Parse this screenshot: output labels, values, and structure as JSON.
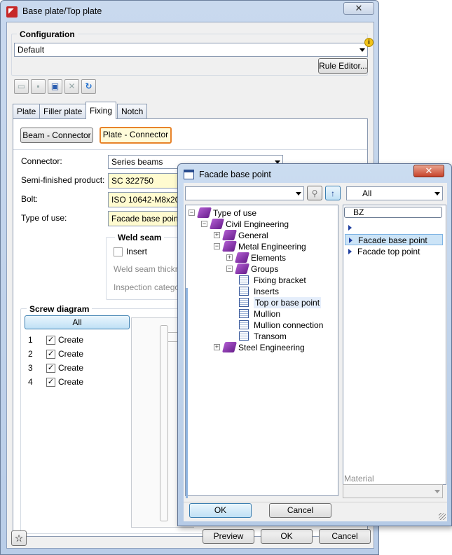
{
  "main_window": {
    "title": "Base plate/Top plate",
    "close_glyph": "✕",
    "configuration": {
      "group_label": "Configuration",
      "selected": "Default",
      "rule_editor_label": "Rule Editor..."
    },
    "tabs": [
      "Plate",
      "Filler plate",
      "Fixing",
      "Notch"
    ],
    "active_tab": "Fixing",
    "connector_buttons": {
      "beam": "Beam - Connector",
      "plate": "Plate - Connector"
    },
    "fields": {
      "connector_label": "Connector:",
      "connector_value": "Series beams",
      "semi_label": "Semi-finished product:",
      "semi_value": "SC  322750",
      "bolt_label": "Bolt:",
      "bolt_value": "ISO 10642-M8x20",
      "use_label": "Type of use:",
      "use_value": "Facade base point"
    },
    "weld_seam": {
      "group_label": "Weld seam",
      "insert_label": "Insert",
      "thickness_label": "Weld seam thickn",
      "inspection_label": "Inspection catego"
    },
    "screw_diagram": {
      "group_label": "Screw diagram",
      "all_label": "All",
      "rows": [
        {
          "num": "1",
          "label": "Create",
          "checked": true
        },
        {
          "num": "2",
          "label": "Create",
          "checked": true
        },
        {
          "num": "3",
          "label": "Create",
          "checked": true
        },
        {
          "num": "4",
          "label": "Create",
          "checked": true
        }
      ]
    },
    "footer": {
      "star_glyph": "☆",
      "preview_label": "Preview",
      "ok_label": "OK",
      "cancel_label": "Cancel"
    }
  },
  "facade_dialog": {
    "title": "Facade base point",
    "close_glyph": "✕",
    "filter_selected": "All",
    "search_value": "BZ",
    "tree": [
      {
        "label": "Type of use",
        "expander": "−",
        "icon": "book"
      },
      {
        "label": "Civil Engineering",
        "expander": "−",
        "icon": "book"
      },
      {
        "label": "General",
        "expander": "+",
        "icon": "book"
      },
      {
        "label": "Metal Engineering",
        "expander": "−",
        "icon": "book"
      },
      {
        "label": "Elements",
        "expander": "+",
        "icon": "book"
      },
      {
        "label": "Groups",
        "expander": "−",
        "icon": "book"
      },
      {
        "label": "Fixing bracket",
        "expander": "",
        "icon": "table"
      },
      {
        "label": "Inserts",
        "expander": "",
        "icon": "table"
      },
      {
        "label": "Top or base point",
        "expander": "",
        "icon": "table"
      },
      {
        "label": "Mullion",
        "expander": "",
        "icon": "table"
      },
      {
        "label": "Mullion connection",
        "expander": "",
        "icon": "table"
      },
      {
        "label": "Transom",
        "expander": "",
        "icon": "table"
      },
      {
        "label": "Steel Engineering",
        "expander": "+",
        "icon": "book"
      }
    ],
    "list": [
      "",
      "Facade base point",
      "Facade top point"
    ],
    "selected_list_item": "Facade base point",
    "material_label": "Material",
    "ok_label": "OK",
    "cancel_label": "Cancel"
  },
  "colors": {
    "highlight_border": "#e8832a",
    "selection": "#cce4f7",
    "book_icon": "#7b2a9e"
  }
}
